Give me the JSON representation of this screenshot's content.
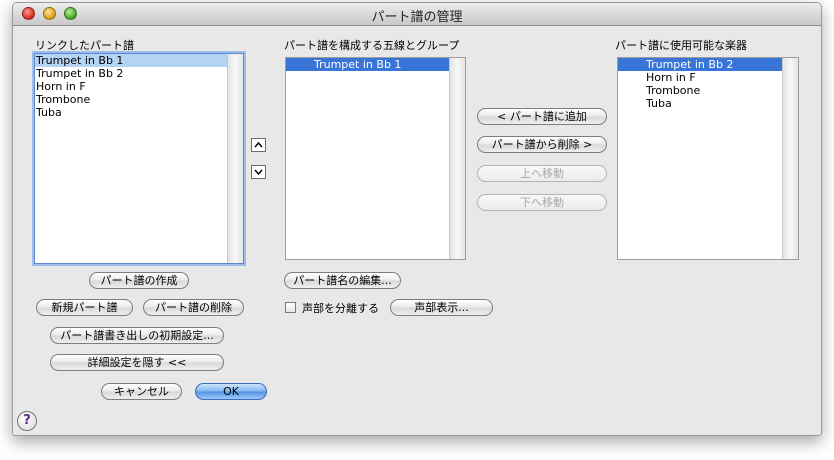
{
  "window": {
    "title": "パート譜の管理"
  },
  "linked_parts": {
    "label": "リンクしたパート譜",
    "items": [
      "Trumpet in Bb 1",
      "Trumpet in Bb 2",
      "Horn in F",
      "Trombone",
      "Tuba"
    ],
    "selected_index": 0
  },
  "staves_groups": {
    "label": "パート譜を構成する五線とグループ",
    "items": [
      "Trumpet in Bb 1"
    ]
  },
  "available_instruments": {
    "label": "パート譜に使用可能な楽器",
    "items": [
      "Trumpet in Bb 2",
      "Horn in F",
      "Trombone",
      "Tuba"
    ],
    "selected_index": 0
  },
  "buttons": {
    "add_to_part": "< パート譜に追加",
    "remove_from_part": "パート譜から削除 >",
    "move_up": "上へ移動",
    "move_down": "下へ移動",
    "create_part": "パート譜の作成",
    "new_part": "新規パート譜",
    "delete_part": "パート譜の削除",
    "extraction_defaults": "パート譜書き出しの初期設定...",
    "hide_advanced": "詳細設定を隠す <<",
    "cancel": "キャンセル",
    "ok": "OK",
    "edit_part_name": "パート譜名の編集...",
    "voice_display": "声部表示..."
  },
  "checkbox": {
    "split_voices": "声部を分離する",
    "checked": false
  },
  "help": {
    "symbol": "?"
  }
}
